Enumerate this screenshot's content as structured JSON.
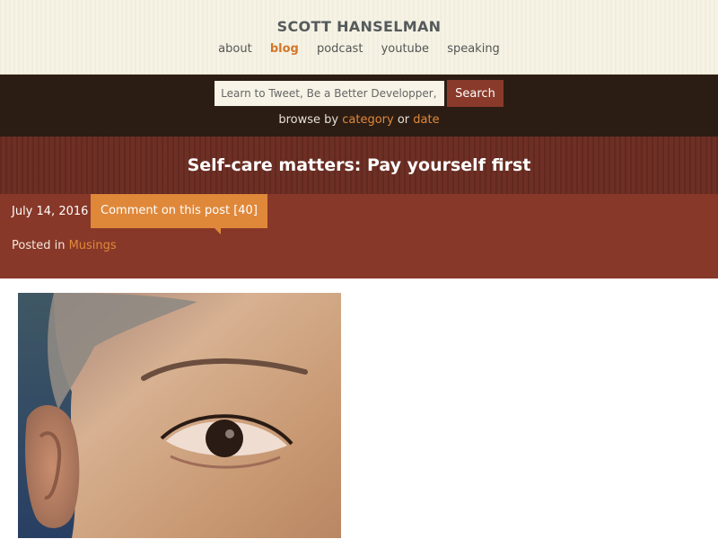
{
  "site": {
    "title": "SCOTT HANSELMAN",
    "nav": [
      {
        "label": "about",
        "active": false
      },
      {
        "label": "blog",
        "active": true
      },
      {
        "label": "podcast",
        "active": false
      },
      {
        "label": "youtube",
        "active": false
      },
      {
        "label": "speaking",
        "active": false
      }
    ]
  },
  "search": {
    "placeholder": "Learn to Tweet, Be a Better Developper, etc.",
    "value": "",
    "button_label": "Search",
    "browse_prefix": "browse by",
    "browse_category": "category",
    "browse_or": "or",
    "browse_date": "date"
  },
  "post": {
    "title": "Self-care matters: Pay yourself first",
    "date": "July 14, 2016",
    "comment_label": "Comment on this post [40]",
    "posted_in_prefix": "Posted in",
    "category": "Musings"
  },
  "colors": {
    "accent": "#e0883a",
    "header_bg": "#f6f3e4",
    "search_band_bg": "#2b1d14",
    "title_band_bg": "#6e2f24",
    "meta_band_bg": "#883828",
    "search_button_bg": "#8a3a2a"
  }
}
